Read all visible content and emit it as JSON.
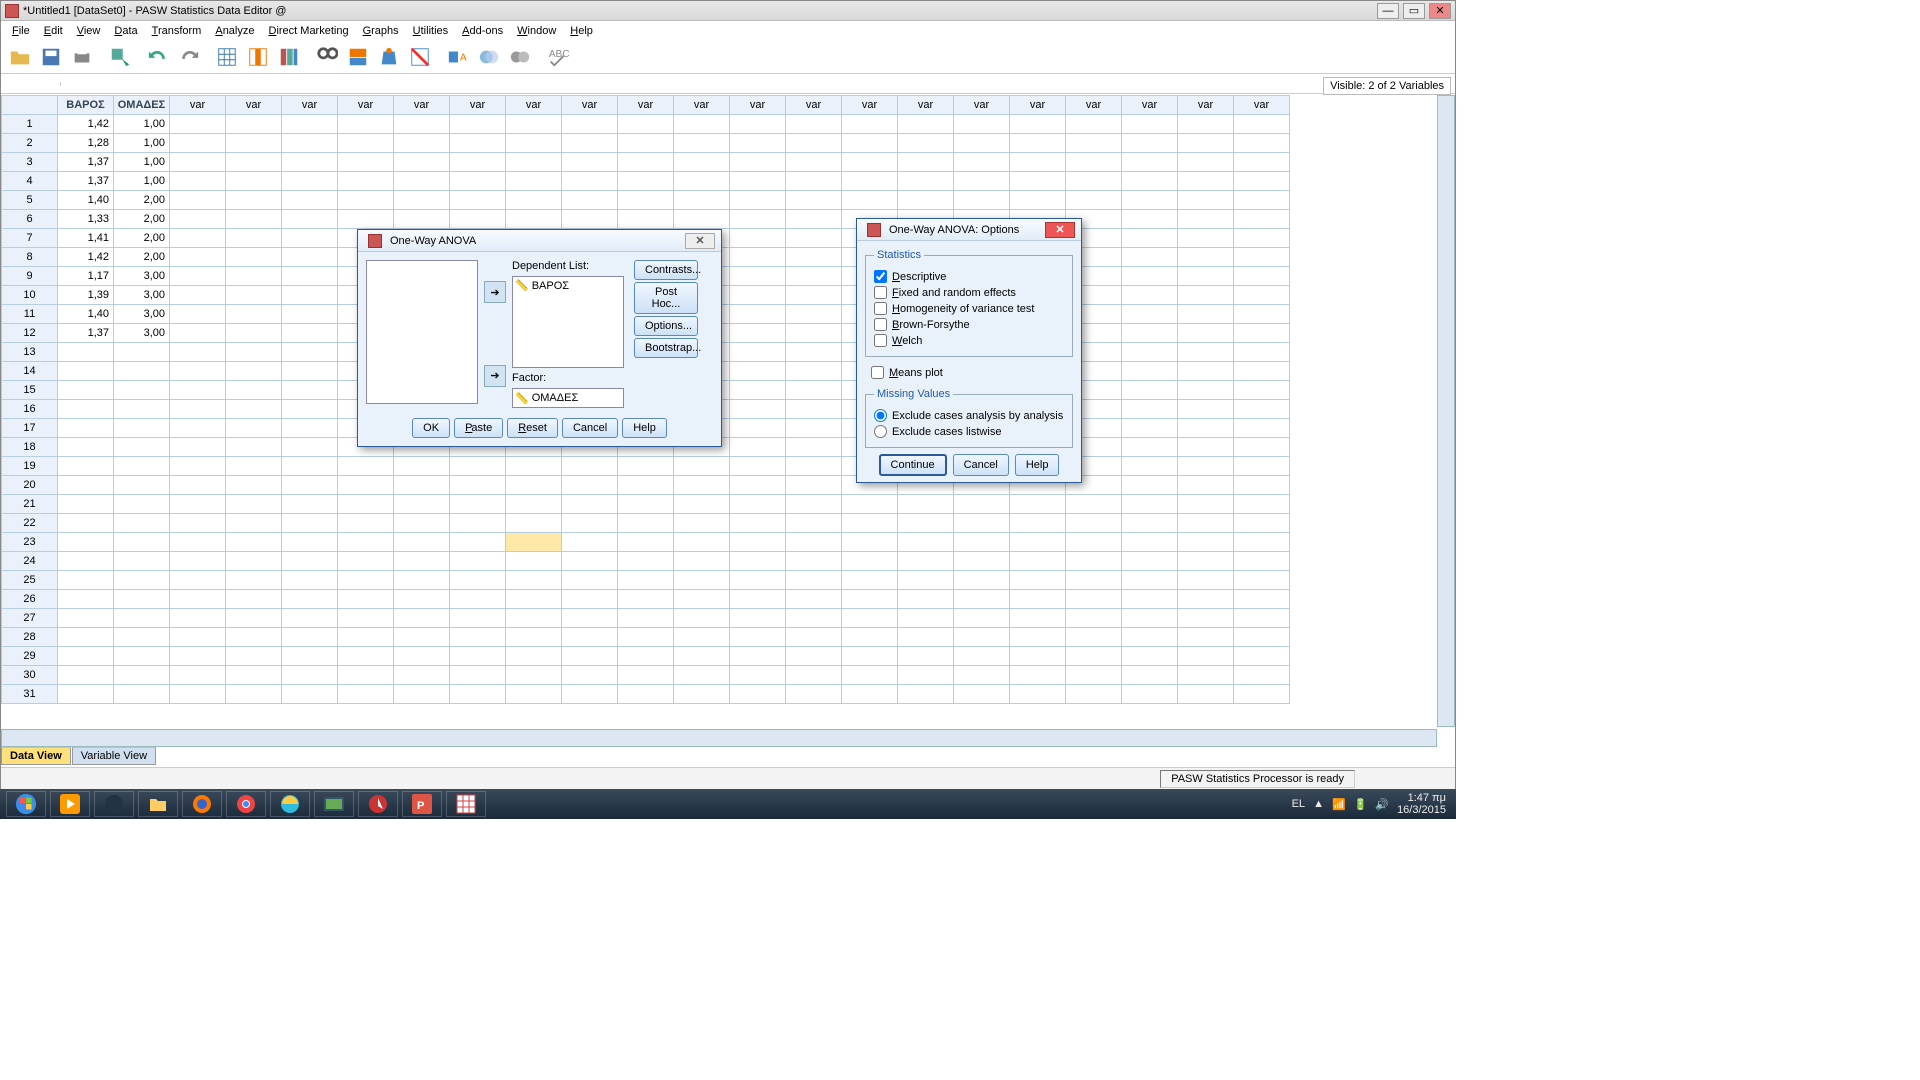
{
  "window": {
    "title": "*Untitled1 [DataSet0] - PASW Statistics Data Editor @"
  },
  "menus": [
    "File",
    "Edit",
    "View",
    "Data",
    "Transform",
    "Analyze",
    "Direct Marketing",
    "Graphs",
    "Utilities",
    "Add-ons",
    "Window",
    "Help"
  ],
  "visible_vars": "Visible: 2 of 2 Variables",
  "columns": [
    "ΒΑΡΟΣ",
    "ΟΜΑΔΕΣ",
    "var",
    "var",
    "var",
    "var",
    "var",
    "var",
    "var",
    "var",
    "var",
    "var",
    "var",
    "var",
    "var",
    "var",
    "var",
    "var",
    "var",
    "var",
    "var",
    "var"
  ],
  "rows": [
    {
      "n": 1,
      "a": "1,42",
      "b": "1,00"
    },
    {
      "n": 2,
      "a": "1,28",
      "b": "1,00"
    },
    {
      "n": 3,
      "a": "1,37",
      "b": "1,00"
    },
    {
      "n": 4,
      "a": "1,37",
      "b": "1,00"
    },
    {
      "n": 5,
      "a": "1,40",
      "b": "2,00"
    },
    {
      "n": 6,
      "a": "1,33",
      "b": "2,00"
    },
    {
      "n": 7,
      "a": "1,41",
      "b": "2,00"
    },
    {
      "n": 8,
      "a": "1,42",
      "b": "2,00"
    },
    {
      "n": 9,
      "a": "1,17",
      "b": "3,00"
    },
    {
      "n": 10,
      "a": "1,39",
      "b": "3,00"
    },
    {
      "n": 11,
      "a": "1,40",
      "b": "3,00"
    },
    {
      "n": 12,
      "a": "1,37",
      "b": "3,00"
    }
  ],
  "empty_rows": [
    13,
    14,
    15,
    16,
    17,
    18,
    19,
    20,
    21,
    22,
    23,
    24,
    25,
    26,
    27,
    28,
    29,
    30,
    31
  ],
  "sel_row": 23,
  "tabs": {
    "data": "Data View",
    "variable": "Variable View"
  },
  "status": "PASW Statistics Processor is ready",
  "anova": {
    "title": "One-Way ANOVA",
    "dep_label": "Dependent List:",
    "dep_var": "ΒΑΡΟΣ",
    "factor_label": "Factor:",
    "factor_var": "ΟΜΑΔΕΣ",
    "buttons": {
      "contrasts": "Contrasts...",
      "posthoc": "Post Hoc...",
      "options": "Options...",
      "bootstrap": "Bootstrap..."
    },
    "foot": {
      "ok": "OK",
      "paste": "Paste",
      "reset": "Reset",
      "cancel": "Cancel",
      "help": "Help"
    }
  },
  "options": {
    "title": "One-Way ANOVA: Options",
    "stat_legend": "Statistics",
    "items": {
      "desc": "Descriptive",
      "fixed": "Fixed and random effects",
      "homo": "Homogeneity of variance test",
      "brown": "Brown-Forsythe",
      "welch": "Welch",
      "means": "Means plot"
    },
    "miss_legend": "Missing Values",
    "miss": {
      "byanalysis": "Exclude cases analysis by analysis",
      "listwise": "Exclude cases listwise"
    },
    "foot": {
      "cont": "Continue",
      "cancel": "Cancel",
      "help": "Help"
    }
  },
  "tray": {
    "lang": "EL",
    "time": "1:47 πμ",
    "date": "16/3/2015"
  }
}
